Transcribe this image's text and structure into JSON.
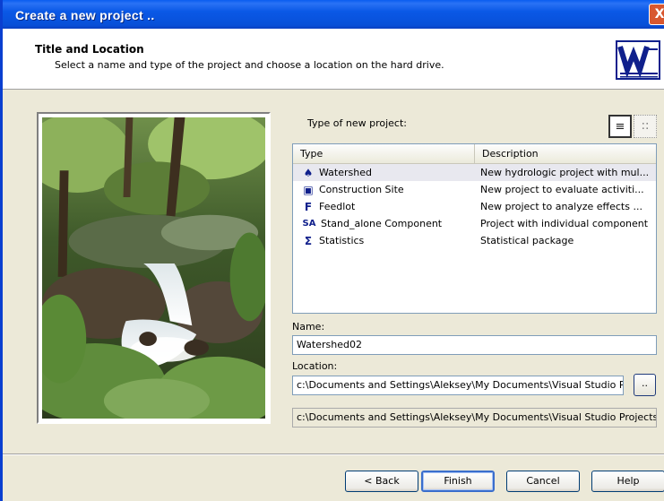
{
  "window": {
    "title": "Create a new project ..",
    "close_glyph": "X"
  },
  "header": {
    "title": "Title and Location",
    "subtitle": "Select a name and type of the project and choose a location on the hard drive."
  },
  "project_type": {
    "label": "Type of new project:",
    "view_buttons": [
      {
        "name": "details-view-icon",
        "glyph": "≡"
      },
      {
        "name": "large-icons-view-icon",
        "glyph": "::"
      }
    ],
    "columns": [
      "Type",
      "Description"
    ],
    "items": [
      {
        "icon": "watershed-icon",
        "glyph": "♠",
        "type": "Watershed",
        "description": "New hydrologic project with mul..."
      },
      {
        "icon": "construction-site-icon",
        "glyph": "▣",
        "type": "Construction Site",
        "description": "New project to evaluate activiti..."
      },
      {
        "icon": "feedlot-icon",
        "glyph": "F",
        "type": "Feedlot",
        "description": "New project to analyze effects ..."
      },
      {
        "icon": "standalone-component-icon",
        "glyph": "SA",
        "type": "Stand_alone Component",
        "description": "Project with individual component"
      },
      {
        "icon": "statistics-icon",
        "glyph": "Σ",
        "type": "Statistics",
        "description": "Statistical package"
      }
    ]
  },
  "name_field": {
    "label": "Name:",
    "value": "Watershed02"
  },
  "location_field": {
    "label": "Location:",
    "value": "c:\\Documents and Settings\\Aleksey\\My Documents\\Visual Studio P",
    "browse_label": "..",
    "full_path": "c:\\Documents and Settings\\Aleksey\\My Documents\\Visual Studio Projects\\"
  },
  "buttons": {
    "back": "< Back",
    "finish": "Finish",
    "cancel": "Cancel",
    "help": "Help"
  },
  "colors": {
    "titlebar": "#0a58e6",
    "dialog": "#ece9d8",
    "selection": "#e8e8ef"
  }
}
